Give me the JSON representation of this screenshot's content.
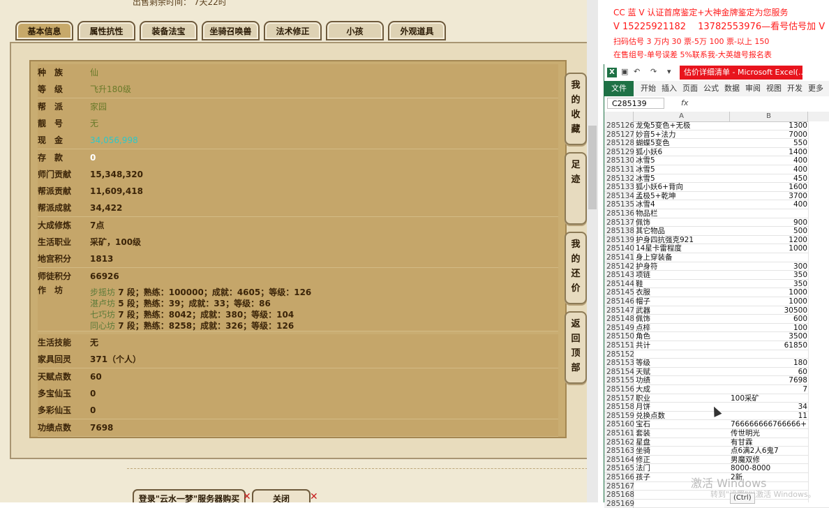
{
  "game": {
    "sale_time": "出售剩余时间： 7天22时",
    "tabs": [
      "基本信息",
      "属性抗性",
      "装备法宝",
      "坐骑召唤兽",
      "法术修正",
      "小孩",
      "外观道具"
    ],
    "rows": [
      {
        "label": "种　族",
        "value": "仙",
        "style": "green"
      },
      {
        "label": "等　级",
        "value": "飞升180级",
        "style": "green"
      },
      {
        "label": "帮　派",
        "value": "家园",
        "style": "green"
      },
      {
        "label": "靓　号",
        "value": "无",
        "style": "green"
      },
      {
        "label": "现　金",
        "value": "34,056,998",
        "style": "cyan"
      },
      {
        "label": "存　款",
        "value": "0",
        "style": "white"
      },
      {
        "label": "师门贡献",
        "value": "15,348,320",
        "style": ""
      },
      {
        "label": "帮派贡献",
        "value": "11,609,418",
        "style": ""
      },
      {
        "label": "帮派成就",
        "value": "34,422",
        "style": ""
      },
      {
        "label": "大成修炼",
        "value": "7点",
        "style": ""
      },
      {
        "label": "生活职业",
        "value": "采矿，100级",
        "style": ""
      },
      {
        "label": "地宫积分",
        "value": "1813",
        "style": ""
      },
      {
        "label": "师徒积分",
        "value": "66926",
        "style": ""
      }
    ],
    "workshop": {
      "label": "作　坊",
      "lines": [
        {
          "name": "步摇坊",
          "text": " 7 段；熟练：100000；成就：4605；等级：126"
        },
        {
          "name": "湛卢坊",
          "text": " 5 段；熟练：39；成就：33；等级：86"
        },
        {
          "name": "七巧坊",
          "text": " 7 段；熟练：8042；成就：380；等级：104"
        },
        {
          "name": "同心坊",
          "text": " 7 段；熟练：8258；成就：326；等级：126"
        }
      ]
    },
    "rows2": [
      {
        "label": "生活技能",
        "value": "无"
      },
      {
        "label": "家具回灵",
        "value": "371（个人）"
      },
      {
        "label": "天赋点数",
        "value": "60"
      },
      {
        "label": "多宝仙玉",
        "value": "0"
      },
      {
        "label": "多彩仙玉",
        "value": "0"
      },
      {
        "label": "功绩点数",
        "value": "7698"
      }
    ],
    "side_buttons": [
      "我的收藏",
      "足迹",
      "我的还价",
      "返回顶部"
    ],
    "bottom_buttons": [
      "登录\"云水一梦\"服务器购买",
      "关闭"
    ]
  },
  "word": {
    "lines": [
      "CC 蓝 V 认证首席鉴定+大神金牌鉴定为您服务",
      "V 15225921182　 13782553976—看号估号加 V",
      "扫码估号 3 万内 30 票-5万 100 票-以上 150",
      "在售组号-单号误差 5%联系我-大英雄号报名表"
    ]
  },
  "excel": {
    "title": "估价详细清单 - Microsoft Excel(...",
    "ribbon_tabs": [
      "文件",
      "开始",
      "插入",
      "页面",
      "公式",
      "数据",
      "审阅",
      "视图",
      "开发",
      "更多"
    ],
    "name_box": "C285139",
    "fx": "fx",
    "col_headers": [
      "A",
      "B"
    ],
    "rows": [
      [
        "285126",
        "龙兔5变色+无极",
        "1300"
      ],
      [
        "285127",
        "妙音5+法力",
        "7000"
      ],
      [
        "285128",
        "蝴蝶5变色",
        "550"
      ],
      [
        "285129",
        "狐小妖6",
        "1400"
      ],
      [
        "285130",
        "冰雪5",
        "400"
      ],
      [
        "285131",
        "冰雪5",
        "400"
      ],
      [
        "285132",
        "冰雪5",
        "450"
      ],
      [
        "285133",
        "狐小妖6+背向",
        "1600"
      ],
      [
        "285134",
        "孟极5+乾坤",
        "3700"
      ],
      [
        "285135",
        "冰雪4",
        "400"
      ],
      [
        "285136",
        "物品栏",
        ""
      ],
      [
        "285137",
        "佩饰",
        "900"
      ],
      [
        "285138",
        "其它物品",
        "500"
      ],
      [
        "285139",
        "护身四抗强克921",
        "1200"
      ],
      [
        "285140",
        "14星卡雷程度",
        "1000"
      ],
      [
        "285141",
        "身上穿装备",
        ""
      ],
      [
        "285142",
        "护身符",
        "300"
      ],
      [
        "285143",
        "项链",
        "350"
      ],
      [
        "285144",
        "鞋",
        "350"
      ],
      [
        "285145",
        "衣服",
        "1000"
      ],
      [
        "285146",
        "帽子",
        "1000"
      ],
      [
        "285147",
        "武器",
        "30500"
      ],
      [
        "285148",
        "佩饰",
        "600"
      ],
      [
        "285149",
        "点椊",
        "100"
      ],
      [
        "285150",
        "角色",
        "3500"
      ],
      [
        "285151",
        "共计",
        "61850"
      ],
      [
        "285152",
        "",
        ""
      ],
      [
        "285153",
        "等级",
        "180"
      ],
      [
        "285154",
        "天赋",
        "60"
      ],
      [
        "285155",
        "功绩",
        "7698"
      ],
      [
        "285156",
        "大成",
        "7"
      ],
      [
        "285157",
        "职业",
        "100采矿"
      ],
      [
        "285158",
        "月饼",
        "34"
      ],
      [
        "285159",
        "兑换点数",
        "11"
      ],
      [
        "285160",
        "宝石",
        "766666666766666+"
      ],
      [
        "285161",
        "套装",
        "传世明光"
      ],
      [
        "285162",
        "星盘",
        "有甘霖"
      ],
      [
        "285163",
        "坐骑",
        "点6满2人6鬼7"
      ],
      [
        "285164",
        "修正",
        "男魔双修"
      ],
      [
        "285165",
        "法门",
        "8000-8000"
      ],
      [
        "285166",
        "孩子",
        "2新"
      ],
      [
        "285167",
        "",
        ""
      ],
      [
        "285168",
        "",
        ""
      ],
      [
        "285169",
        "",
        ""
      ]
    ],
    "left_aligned_from": "285157"
  },
  "overlay": {
    "activate_title": "激活 Windows",
    "activate_sub": "转到\"设置\"以激活 Windows。",
    "ctrl_tip": "(Ctrl)"
  }
}
